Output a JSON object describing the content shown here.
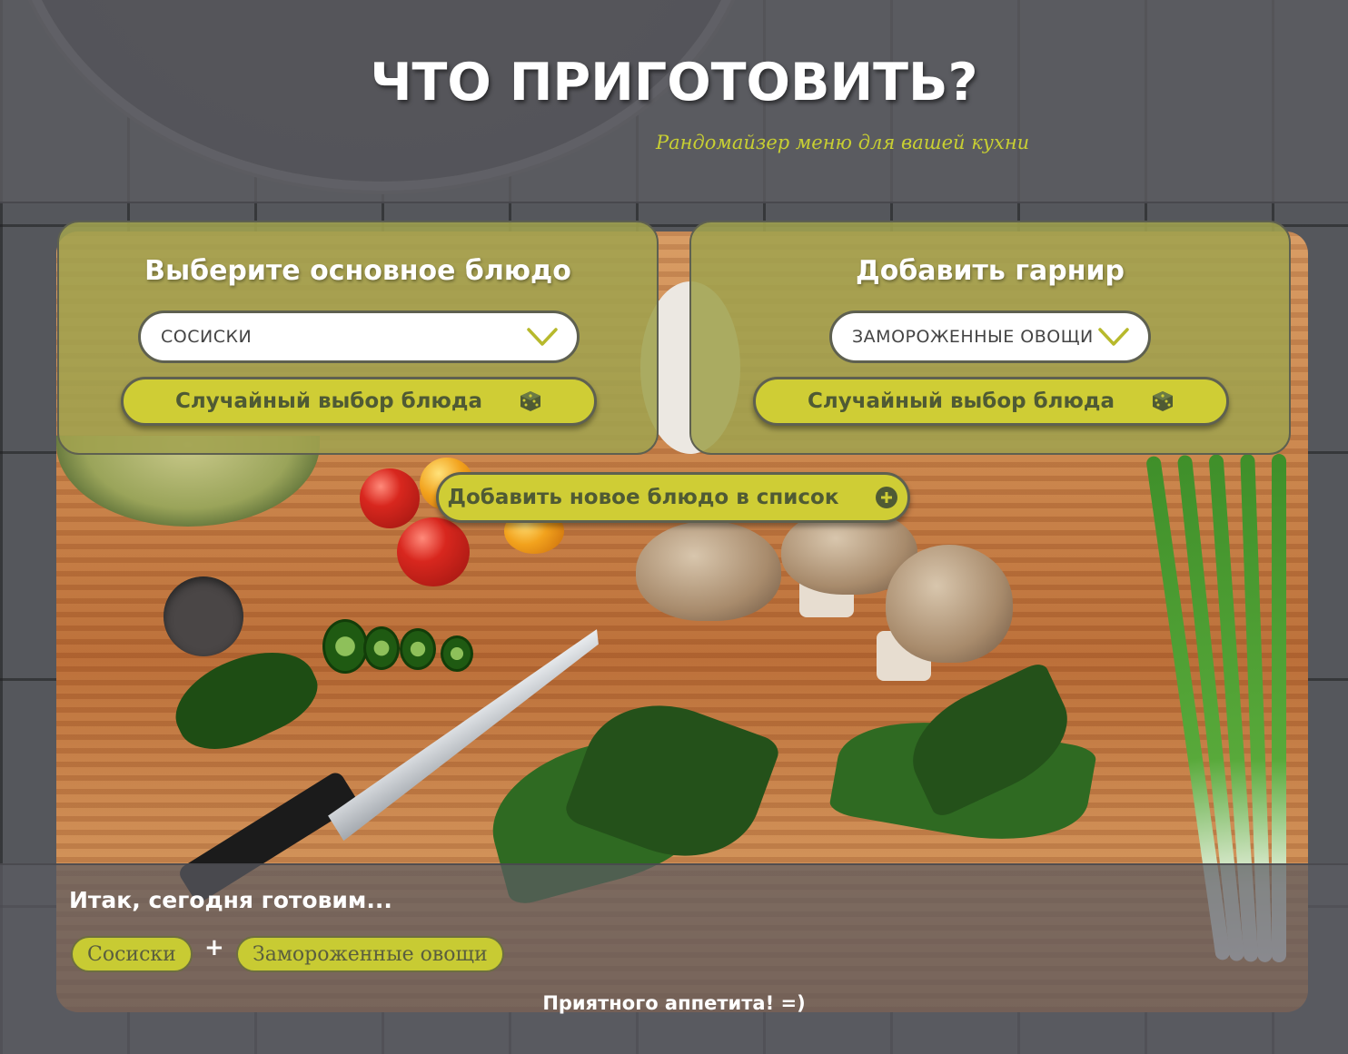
{
  "header": {
    "title": "ЧТО ПРИГОТОВИТЬ?",
    "subtitle": "Рандомайзер меню для вашей кухни"
  },
  "main_dish": {
    "title": "Выберите основное блюдо",
    "selected": "СОСИСКИ",
    "random_label": "Случайный выбор блюда"
  },
  "side_dish": {
    "title": "Добавить гарнир",
    "selected": "ЗАМОРОЖЕННЫЕ ОВОЩИ",
    "random_label": "Случайный выбор блюда"
  },
  "add_new": {
    "label": "Добавить новое блюдо в список"
  },
  "result": {
    "heading": "Итак, сегодня готовим...",
    "main": "Сосиски",
    "plus": "+",
    "side": "Замороженные овощи",
    "closing": "Приятного аппетита! =)"
  },
  "colors": {
    "accent": "#cfcd35",
    "panel": "#a0a24e",
    "subtitle": "#c8cf32",
    "overlay": "#5c5c62"
  },
  "icons": {
    "chevron": "chevron-down-icon",
    "dice": "dice-icon",
    "add": "plus-circle-icon"
  }
}
